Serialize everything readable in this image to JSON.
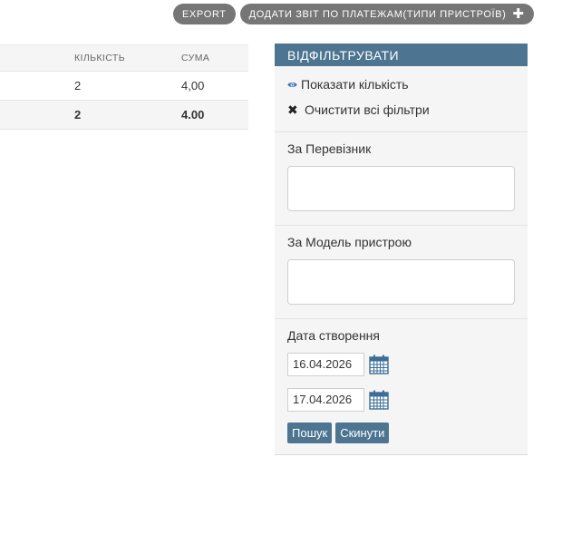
{
  "top_actions": {
    "export_label": "EXPORT",
    "add_label": "ДОДАТИ ЗВІТ ПО ПЛАТЕЖАМ(ТИПИ ПРИСТРОЇВ)",
    "add_icon": "plus-icon"
  },
  "table": {
    "headers": [
      "КІЛЬКІСТЬ",
      "СУМА"
    ],
    "rows": [
      {
        "count": "2",
        "sum": "4,00"
      }
    ],
    "total": {
      "count": "2",
      "sum": "4.00"
    }
  },
  "filter": {
    "title": "ВІДФІЛЬТРУВАТИ",
    "show_count_label": "Показати кількість",
    "clear_filters_label": "Очистити всі фільтри",
    "carrier_label": "За Перевізник",
    "carrier_value": "",
    "model_label": "За Модель пристрою",
    "model_value": "",
    "date_label": "Дата створення",
    "date_from": "16.04.2026",
    "date_to": "17.04.2026",
    "search_label": "Пошук",
    "reset_label": "Скинути"
  },
  "colors": {
    "accent": "#4d7591",
    "pill": "#767676",
    "panel": "#f5f5f5"
  }
}
